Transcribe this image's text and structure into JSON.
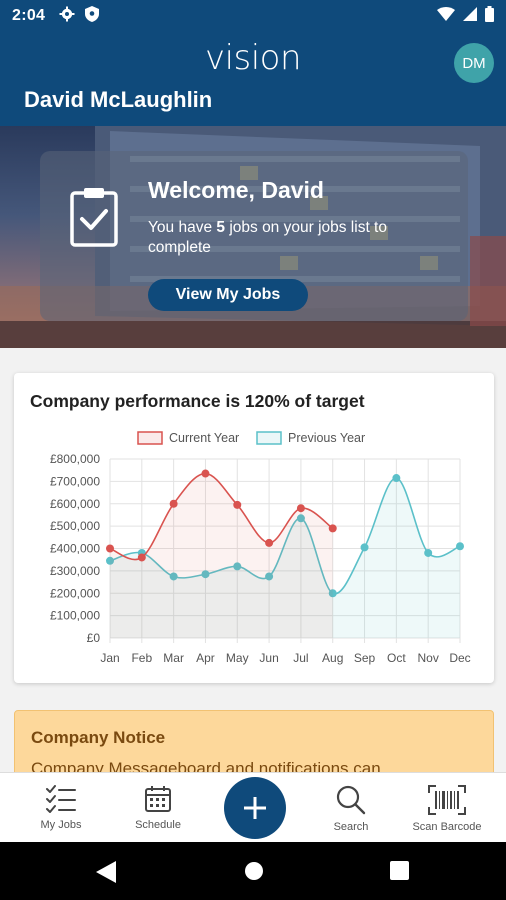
{
  "status_bar": {
    "time": "2:04"
  },
  "header": {
    "logo": "vision",
    "avatar_initials": "DM",
    "user_name": "David McLaughlin"
  },
  "welcome": {
    "title": "Welcome, David",
    "text_before": "You have ",
    "job_count": "5",
    "text_after": " jobs on your jobs list to complete",
    "button_label": "View My Jobs"
  },
  "performance": {
    "title": "Company performance is 120% of target",
    "chart_data": {
      "type": "line",
      "x": [
        "Jan",
        "Feb",
        "Mar",
        "Apr",
        "May",
        "Jun",
        "Jul",
        "Aug",
        "Sep",
        "Oct",
        "Nov",
        "Dec"
      ],
      "series": [
        {
          "name": "Current Year",
          "color": "#d9534f",
          "values": [
            400000,
            360000,
            600000,
            735000,
            595000,
            425000,
            580000,
            490000,
            null,
            null,
            null,
            null
          ]
        },
        {
          "name": "Previous Year",
          "color": "#5bc0c9",
          "values": [
            345000,
            380000,
            275000,
            285000,
            320000,
            275000,
            535000,
            200000,
            405000,
            715000,
            380000,
            410000
          ]
        }
      ],
      "y_ticks": [
        "£800,000",
        "£700,000",
        "£600,000",
        "£500,000",
        "£400,000",
        "£300,000",
        "£200,000",
        "£100,000",
        "£0"
      ],
      "ylim": [
        0,
        800000
      ],
      "grid": true,
      "legend": "top-center"
    }
  },
  "notice": {
    "title": "Company Notice",
    "text": "Company Messageboard and notifications can"
  },
  "bottom_nav": {
    "my_jobs": "My Jobs",
    "schedule": "Schedule",
    "search": "Search",
    "scan_barcode": "Scan Barcode"
  }
}
